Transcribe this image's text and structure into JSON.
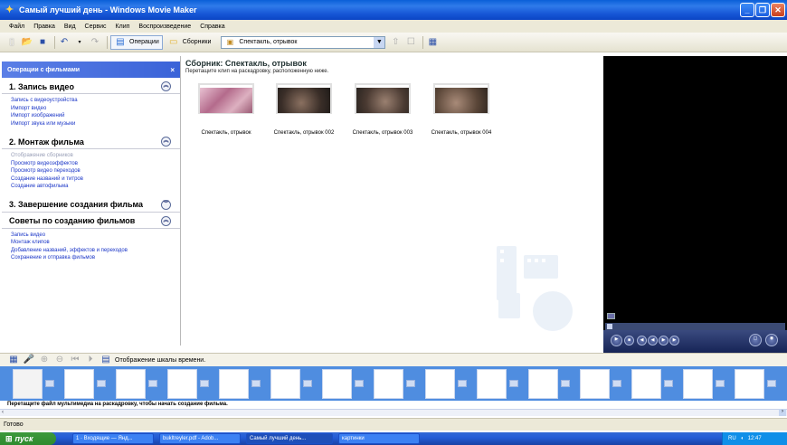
{
  "window": {
    "title": "Самый лучший день - Windows Movie Maker",
    "app_icon": "movie-maker-icon"
  },
  "menu": [
    "Файл",
    "Правка",
    "Вид",
    "Сервис",
    "Клип",
    "Воспроизведение",
    "Справка"
  ],
  "toolbar": {
    "operations_label": "Операции",
    "collections_label": "Сборники",
    "collection_value": "Спектакль, отрывок"
  },
  "taskpane": {
    "header": "Операции с фильмами",
    "sections": [
      {
        "title": "1. Запись видео",
        "state": "expanded",
        "links": [
          "Запись с видеоустройства",
          "Импорт видео",
          "Импорт изображений",
          "Импорт звука или музыки"
        ]
      },
      {
        "title": "2. Монтаж фильма",
        "state": "expanded",
        "links": [
          "Отображение сборников",
          "Просмотр видеоэффектов",
          "Просмотр видео переходов",
          "Создание названий и титров",
          "Создание автофильма"
        ]
      },
      {
        "title": "3. Завершение создания фильма",
        "state": "collapsed",
        "links": []
      },
      {
        "title": "Советы по созданию фильмов",
        "state": "expanded",
        "links": [
          "Запись видео",
          "Монтаж клипов",
          "Добавление названий, эффектов и переходов",
          "Сохранение и отправка фильмов"
        ]
      }
    ]
  },
  "contents": {
    "title": "Сборник: Спектакль, отрывок",
    "hint": "Перетащите клип на раскадровку, расположенную ниже.",
    "clips": [
      {
        "label": "Спектакль, отрывок",
        "color": "#b46b8c"
      },
      {
        "label": "Спектакль, отрывок 002",
        "color": "#5a4a40"
      },
      {
        "label": "Спектакль, отрывок 003",
        "color": "#6e5a4e"
      },
      {
        "label": "Спектакль, отрывок 004",
        "color": "#7a6658"
      }
    ]
  },
  "storyboard": {
    "toolbar_label": "Отображение шкалы времени.",
    "hint": "Перетащите файл мультимедиа на раскадровку, чтобы начать создание фильма."
  },
  "status": "Готово",
  "taskbar": {
    "start": "пуск",
    "tasks": [
      "1 · Входящие — Янд...",
      "bukltreyler.pdf - Adob...",
      "Самый лучший день...",
      "картинки"
    ],
    "tray": {
      "lang": "RU",
      "time": "12:47"
    }
  },
  "colors": {
    "title_bar": "#1656d6",
    "task_link": "#1b36c7",
    "storyboard": "#4f8de0",
    "preview": "#000000"
  }
}
